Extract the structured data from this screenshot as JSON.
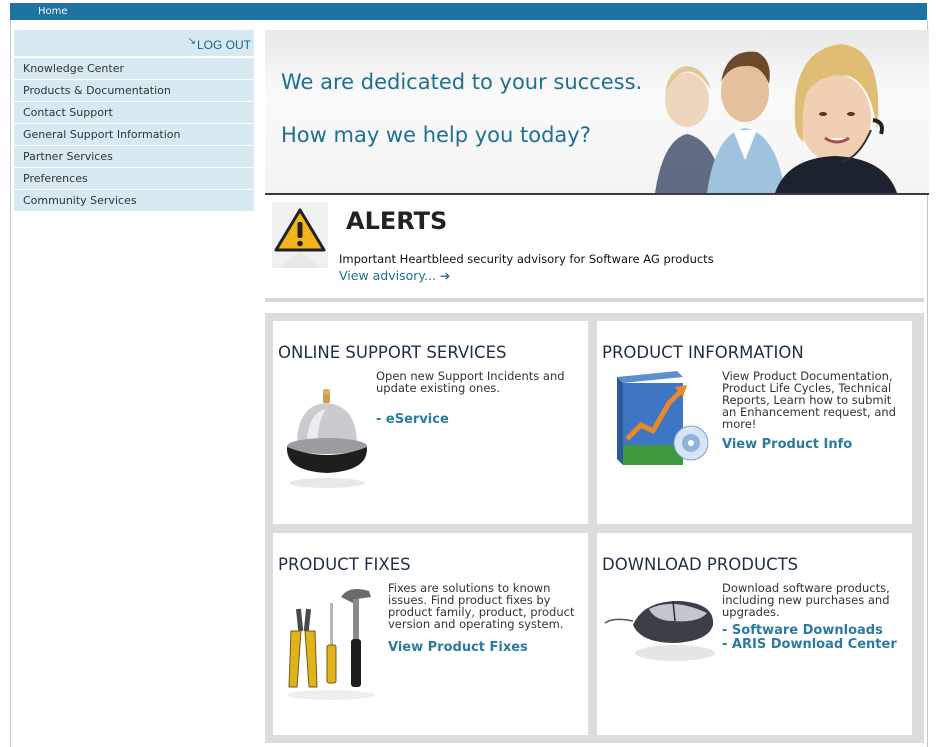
{
  "topbar": {
    "home": "Home"
  },
  "sidebar": {
    "logout": "LOG OUT",
    "items": [
      "Knowledge Center",
      "Products & Documentation",
      "Contact Support",
      "General Support Information",
      "Partner Services",
      "Preferences",
      "Community Services"
    ]
  },
  "banner": {
    "line1": "We are dedicated to your success.",
    "line2": "How may we help you today?"
  },
  "alerts": {
    "title": "ALERTS",
    "text": "Important Heartbleed security advisory for Software AG products",
    "link": "View advisory... ➔"
  },
  "panels": {
    "online": {
      "title": "ONLINE SUPPORT SERVICES",
      "text": "Open new Support Incidents and update existing ones.",
      "link": "- eService"
    },
    "product_info": {
      "title": "PRODUCT INFORMATION",
      "text": "View Product Documentation, Product Life Cycles, Technical Reports, Learn how to submit an Enhancement request, and more!",
      "link": "View Product Info"
    },
    "fixes": {
      "title": "PRODUCT FIXES",
      "text": "Fixes are solutions to known issues. Find product fixes by product family, product, product version and operating system.",
      "link": "View Product Fixes"
    },
    "downloads": {
      "title": "DOWNLOAD PRODUCTS",
      "text": "Download software products, including new purchases and upgrades.",
      "link1": "- Software Downloads",
      "link2": "- ARIS Download Center"
    }
  },
  "colors": {
    "accent": "#1f73a3",
    "sidebar_bg": "#d7eaf2",
    "link": "#2a7ba0"
  }
}
